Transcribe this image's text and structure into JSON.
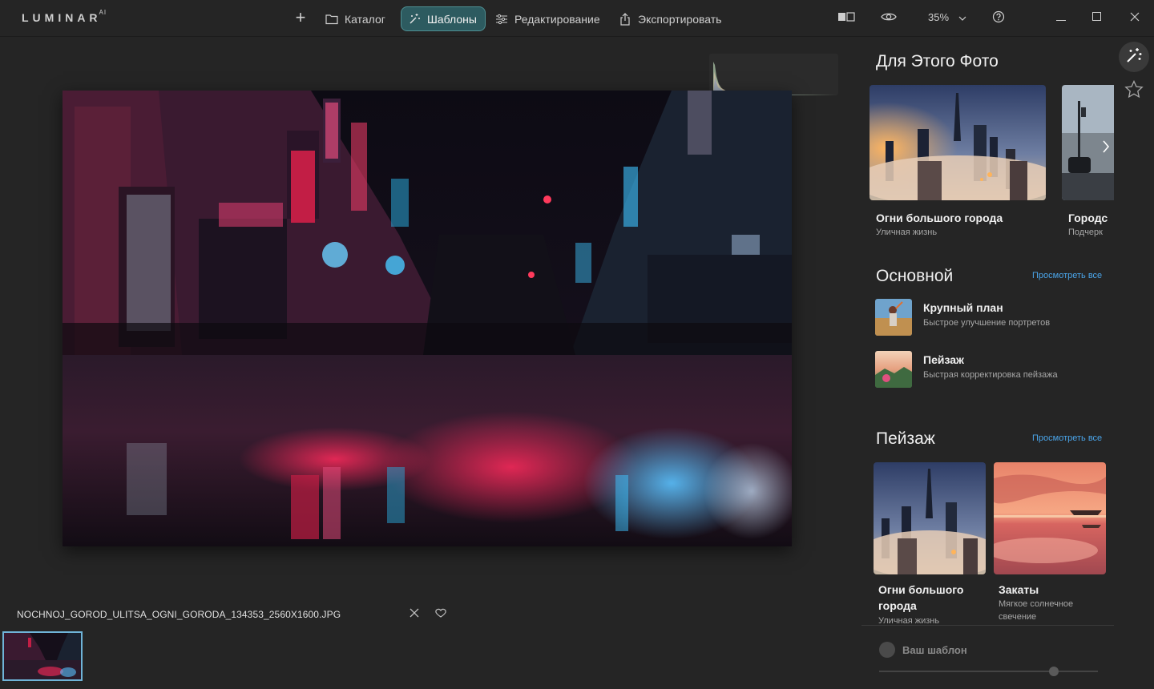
{
  "app": {
    "logo_text": "LUMINAR",
    "logo_suffix": "AI"
  },
  "nav": {
    "add_label": "+",
    "catalog_label": "Каталог",
    "templates_label": "Шаблоны",
    "edit_label": "Редактирование",
    "export_label": "Экспортировать"
  },
  "toolbar": {
    "zoom_value": "35%"
  },
  "colors": {
    "accent": "#2d5b60",
    "accent_border": "#4e8f93",
    "link": "#4aa4e8",
    "background": "#252525"
  },
  "file": {
    "name": "NOCHNOJ_GOROD_ULITSA_OGNI_GORODA_134353_2560X1600.JPG"
  },
  "panel": {
    "for_this_photo": {
      "title": "Для Этого Фото",
      "cards": [
        {
          "title": "Огни большого города",
          "subtitle": "Уличная жизнь"
        },
        {
          "title": "Городс",
          "subtitle": "Подчерк"
        }
      ]
    },
    "basic": {
      "title": "Основной",
      "see_all": "Просмотреть все",
      "items": [
        {
          "title": "Крупный план",
          "subtitle": "Быстрое улучшение портретов"
        },
        {
          "title": "Пейзаж",
          "subtitle": "Быстрая корректировка пейзажа"
        }
      ]
    },
    "landscape": {
      "title": "Пейзаж",
      "see_all": "Просмотреть все",
      "cards": [
        {
          "title": "Огни большого города",
          "subtitle": "Уличная жизнь"
        },
        {
          "title": "Закаты",
          "subtitle": "Мягкое солнечное свечение"
        }
      ]
    },
    "your_template": {
      "label": "Ваш шаблон",
      "slider_value": 0.8
    }
  },
  "icons": {
    "rail": [
      "magic-wand-icon",
      "star-icon"
    ],
    "window": [
      "minimize-icon",
      "maximize-icon",
      "close-icon"
    ]
  }
}
